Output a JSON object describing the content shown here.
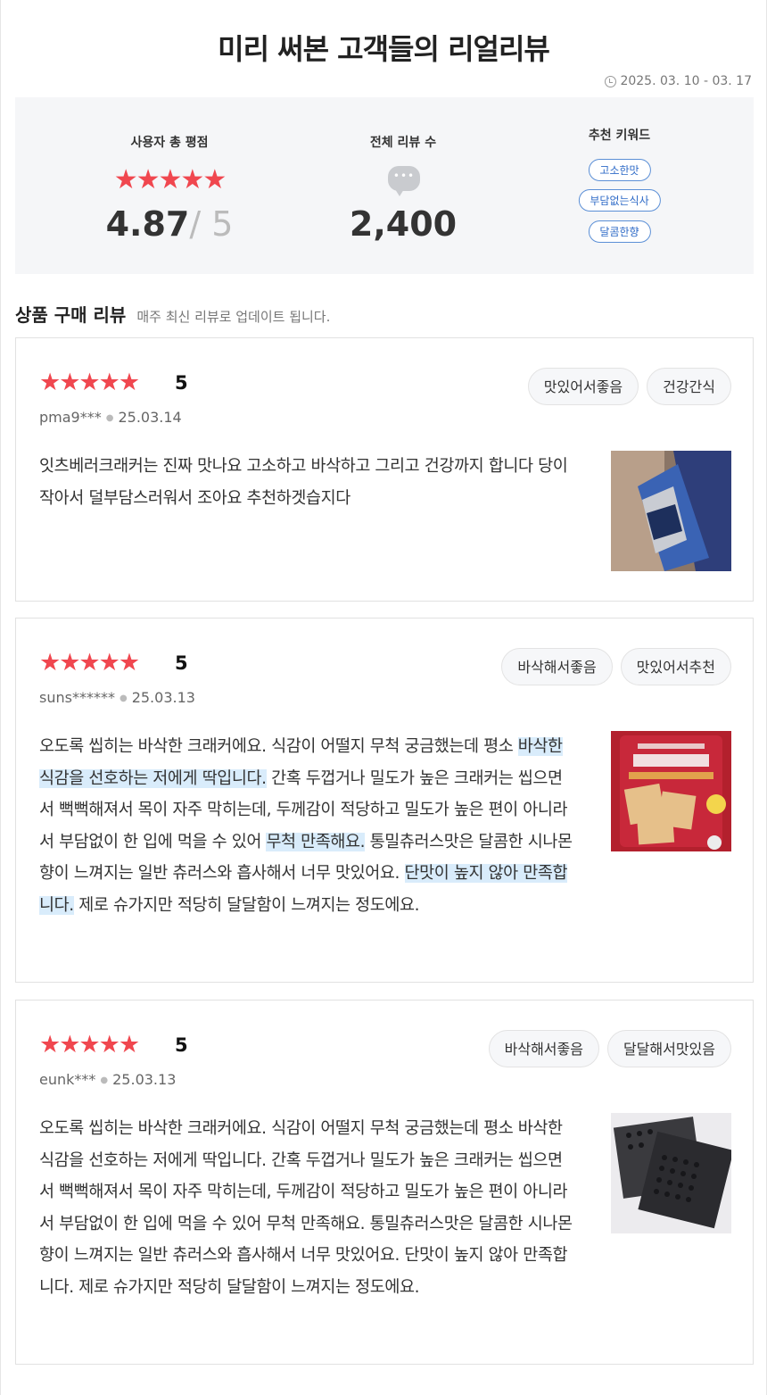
{
  "header": {
    "title": "미리 써본 고객들의 리얼리뷰",
    "period": "2025. 03. 10 - 03. 17"
  },
  "summary": {
    "rating_label": "사용자 총 평점",
    "stars": "★★★★★",
    "rating_value": "4.87",
    "rating_max": "/ 5",
    "review_count_label": "전체 리뷰 수",
    "review_count": "2,400",
    "keywords_label": "추천 키워드",
    "keywords": [
      "고소한맛",
      "부담없는식사",
      "달콤한향"
    ]
  },
  "section": {
    "title": "상품 구매 리뷰",
    "subtitle": "매주 최신 리뷰로 업데이트 됩니다."
  },
  "reviews": [
    {
      "stars": "★★★★★",
      "score": "5",
      "user": "pma9***",
      "date": "25.03.14",
      "tags": [
        "맛있어서좋음",
        "건강간식"
      ],
      "body": [
        {
          "text": "잇츠베러크래커는 진짜 맛나요 고소하고 바삭하고 그리고 건강까지 합니다 당이 작아서 덜부담스러워서 조아요 추천하겟습지다",
          "highlight": false
        }
      ]
    },
    {
      "stars": "★★★★★",
      "score": "5",
      "user": "suns******",
      "date": "25.03.13",
      "tags": [
        "바삭해서좋음",
        "맛있어서추천"
      ],
      "body": [
        {
          "text": "오도록 씹히는 바삭한 크래커에요. 식감이 어떨지 무척 궁금했는데 평소 ",
          "highlight": false
        },
        {
          "text": "바삭한 식감을 선호하는 저에게 딱입니다.",
          "highlight": true
        },
        {
          "text": " 간혹 두껍거나 밀도가 높은 크래커는 씹으면서 뻑뻑해져서 목이 자주 막히는데, 두께감이 적당하고 밀도가 높은 편이 아니라서 부담없이 한 입에 먹을 수 있어 ",
          "highlight": false
        },
        {
          "text": "무척 만족해요.",
          "highlight": true
        },
        {
          "text": " 통밀츄러스맛은 달콤한 시나몬향이 느껴지는 일반 츄러스와 흡사해서 너무 맛있어요. ",
          "highlight": false
        },
        {
          "text": "단맛이 높지 않아 만족합니다.",
          "highlight": true
        },
        {
          "text": " 제로 슈가지만 적당히 달달함이 느껴지는 정도에요.",
          "highlight": false
        }
      ]
    },
    {
      "stars": "★★★★★",
      "score": "5",
      "user": "eunk***",
      "date": "25.03.13",
      "tags": [
        "바삭해서좋음",
        "달달해서맛있음"
      ],
      "body": [
        {
          "text": "오도록 씹히는 바삭한 크래커에요. 식감이 어떨지 무척 궁금했는데 평소 바삭한 식감을 선호하는 저에게 딱입니다. 간혹 두껍거나 밀도가 높은 크래커는 씹으면서 뻑뻑해져서 목이 자주 막히는데, 두께감이 적당하고 밀도가 높은 편이 아니라서 부담없이 한 입에 먹을 수 있어 무척 만족해요. 통밀츄러스맛은 달콤한 시나몬향이 느껴지는 일반 츄러스와 흡사해서 너무 맛있어요. 단맛이 높지 않아 만족합니다. 제로 슈가지만 적당히 달달함이 느껴지는 정도에요.",
          "highlight": false
        }
      ]
    }
  ],
  "colors": {
    "star": "#f0474f",
    "highlight": "#d9ecfb",
    "keyword_border": "#5b8fd6"
  }
}
